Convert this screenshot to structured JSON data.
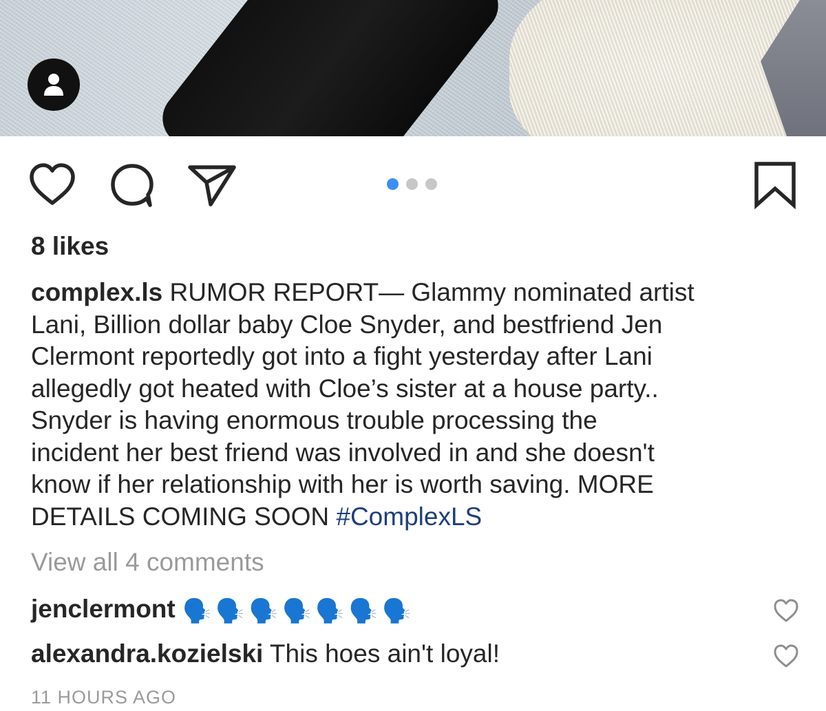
{
  "post": {
    "media_indicator": {
      "count": 3,
      "active_index": 0,
      "active_color": "#3b8ff3",
      "inactive_color": "#c7c7c7"
    },
    "likes_text": "8 likes",
    "caption": {
      "username": "complex.ls",
      "lines": [
        " RUMOR REPORT— Glammy nominated artist",
        "Lani, Billion dollar baby Cloe Snyder, and bestfriend Jen",
        "Clermont reportedly got into a fight yesterday after Lani",
        "allegedly got heated with Cloe’s sister at a house party..",
        "Snyder is having enormous trouble processing the",
        "incident her best friend was involved in and she doesn't",
        "know if her relationship with her is worth saving. MORE",
        "DETAILS COMING SOON "
      ],
      "hashtag": "#ComplexLS"
    },
    "view_all_comments": "View all 4 comments",
    "comments": [
      {
        "username": "jenclermont",
        "text": "",
        "emoji": "🗣️",
        "emoji_count": 7
      },
      {
        "username": "alexandra.kozielski",
        "text": " This hoes ain't loyal!"
      }
    ],
    "timestamp": "11 HOURS AGO"
  },
  "icons": {
    "avatar": "user-silhouette-icon",
    "like": "heart-icon",
    "comment": "comment-bubble-icon",
    "share": "paper-plane-icon",
    "save": "bookmark-icon",
    "comment_like": "small-heart-icon"
  },
  "colors": {
    "text": "#262626",
    "muted": "#9a9a9a",
    "hashtag": "#1d3f7a"
  }
}
